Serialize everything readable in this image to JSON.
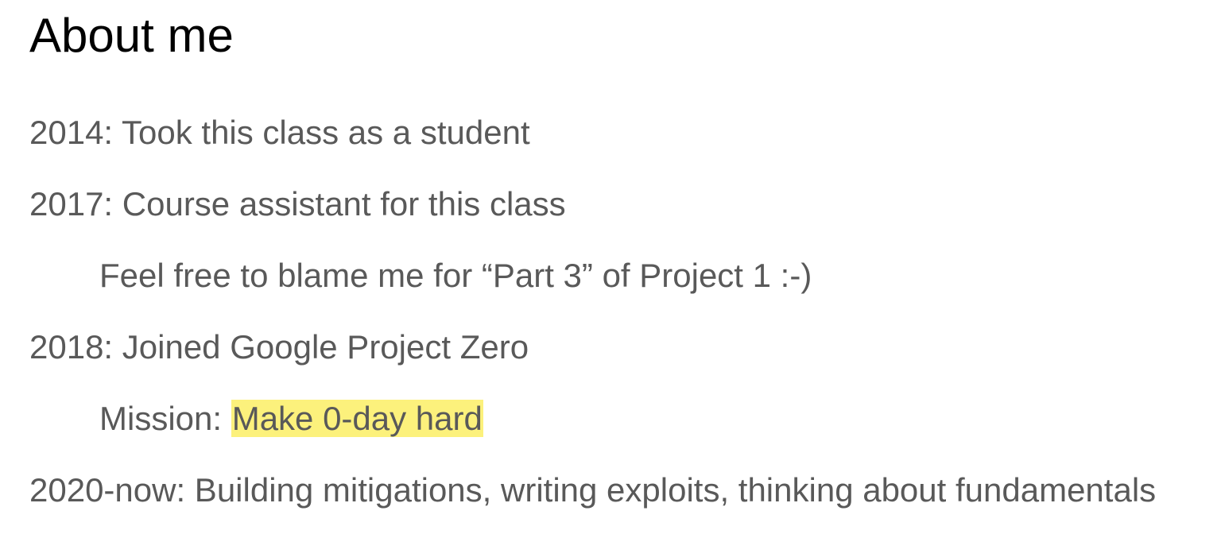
{
  "slide": {
    "title": "About me",
    "lines": [
      {
        "text": "2014: Took this class as a student"
      },
      {
        "text": "2017: Course assistant for this class"
      },
      {
        "text": "Feel free to blame me for “Part 3” of Project 1 :-)"
      },
      {
        "text": "2018: Joined Google Project Zero"
      },
      {
        "prefix": "Mission: ",
        "highlight": "Make 0-day hard"
      },
      {
        "text": "2020-now: Building mitigations, writing exploits, thinking about fundamentals"
      }
    ]
  },
  "colors": {
    "title_text": "#000000",
    "body_text": "#595959",
    "highlight_background": "#fcf17c",
    "background": "#ffffff"
  }
}
